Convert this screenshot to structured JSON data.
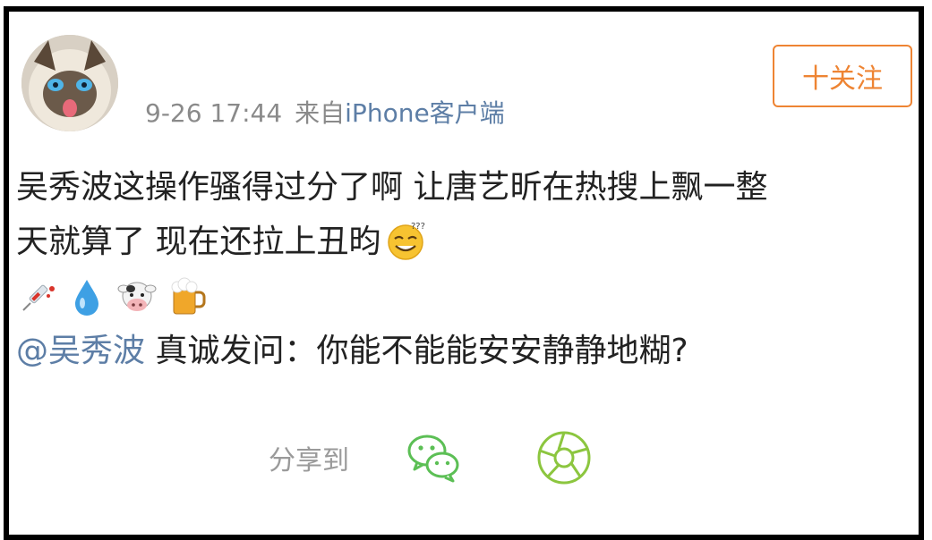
{
  "post": {
    "time": "9-26 17:44",
    "source_prefix": "来自",
    "source_device": "iPhone客户端",
    "follow_label": "十关注",
    "lines": [
      "吴秀波这操作骚得过分了啊 让唐艺昕在热搜上飘一整",
      "天就算了 现在还拉上丑昀"
    ],
    "emoji_inline": "dizzy-smile-emoji",
    "emoji_row": [
      "syringe-emoji",
      "droplet-emoji",
      "cow-face-emoji",
      "beer-mug-emoji"
    ],
    "mention": "@吴秀波",
    "question": " 真诚发问：你能不能能安安静静地糊?"
  },
  "share": {
    "label": "分享到",
    "icons": [
      "wechat-icon",
      "moments-icon"
    ]
  },
  "colors": {
    "accent": "#ee8433",
    "link": "#5d7ea6",
    "meta": "#8a8a8a",
    "wechat": "#5cbf55",
    "moments": "#8cc63f"
  }
}
